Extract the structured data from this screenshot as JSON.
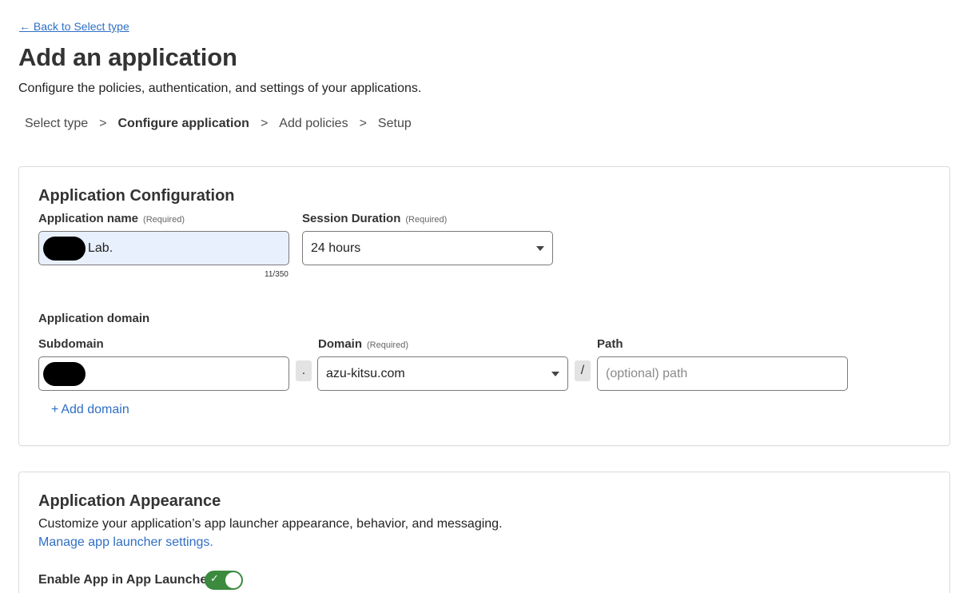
{
  "nav": {
    "back_label": "← Back to Select type"
  },
  "header": {
    "title": "Add an application",
    "subtitle": "Configure the policies, authentication, and settings of your applications."
  },
  "steps": {
    "items": [
      "Select type",
      "Configure application",
      "Add policies",
      "Setup"
    ],
    "separator": ">",
    "active_index": 1
  },
  "config": {
    "title": "Application Configuration",
    "app_name": {
      "label": "Application name",
      "required": "(Required)",
      "value": "Lab.",
      "counter": "11/350"
    },
    "session": {
      "label": "Session Duration",
      "required": "(Required)",
      "value": "24 hours"
    },
    "domain_section_label": "Application domain",
    "subdomain": {
      "label": "Subdomain",
      "value": ""
    },
    "dot": ".",
    "domain": {
      "label": "Domain",
      "required": "(Required)",
      "value": "azu-kitsu.com"
    },
    "slash": "/",
    "path": {
      "label": "Path",
      "placeholder": "(optional) path"
    },
    "add_domain": {
      "plus": "+",
      "label": "Add domain"
    }
  },
  "appearance": {
    "title": "Application Appearance",
    "description": "Customize your application’s app launcher appearance, behavior, and messaging.",
    "manage_link": "Manage app launcher settings.",
    "toggle_label": "Enable App in App Launcher",
    "toggle_on": true
  },
  "colors": {
    "link": "#2f6fc4",
    "toggle_on": "#3b8a3e",
    "input_filled_bg": "#e8f0fe"
  }
}
